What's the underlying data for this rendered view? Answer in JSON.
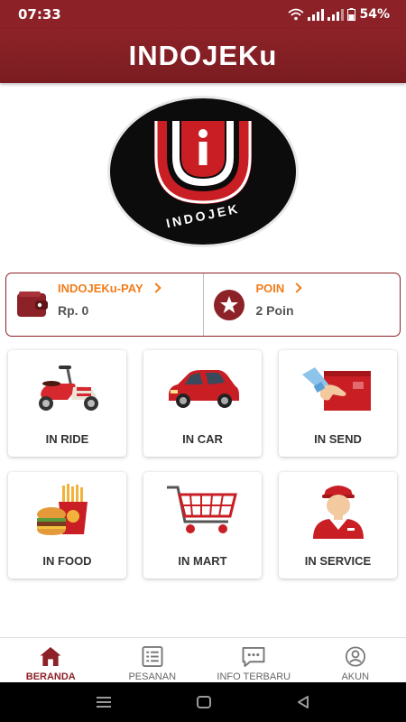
{
  "status_bar": {
    "time": "07:33",
    "battery": "54%"
  },
  "app_bar": {
    "title": "INDOJEKu"
  },
  "logo": {
    "text": "INDOJEK",
    "letter": "i"
  },
  "wallet": {
    "pay": {
      "label": "INDOJEKu-PAY",
      "value": "Rp. 0",
      "icon": "wallet-icon"
    },
    "poin": {
      "label": "POIN",
      "value": "2 Poin",
      "icon": "star-icon"
    }
  },
  "services": [
    {
      "label": "IN RIDE",
      "icon": "scooter-icon"
    },
    {
      "label": "IN CAR",
      "icon": "car-icon"
    },
    {
      "label": "IN SEND",
      "icon": "package-icon"
    },
    {
      "label": "IN FOOD",
      "icon": "food-icon"
    },
    {
      "label": "IN MART",
      "icon": "cart-icon"
    },
    {
      "label": "IN SERVICE",
      "icon": "service-person-icon"
    }
  ],
  "bottom_nav": [
    {
      "label": "BERANDA",
      "icon": "home-icon",
      "active": true
    },
    {
      "label": "PESANAN",
      "icon": "orders-icon",
      "active": false
    },
    {
      "label": "INFO TERBARU",
      "icon": "chat-icon",
      "active": false
    },
    {
      "label": "AKUN",
      "icon": "account-icon",
      "active": false
    }
  ],
  "colors": {
    "brand": "#8c2127",
    "accent": "#f07d1a",
    "text": "#333333"
  }
}
